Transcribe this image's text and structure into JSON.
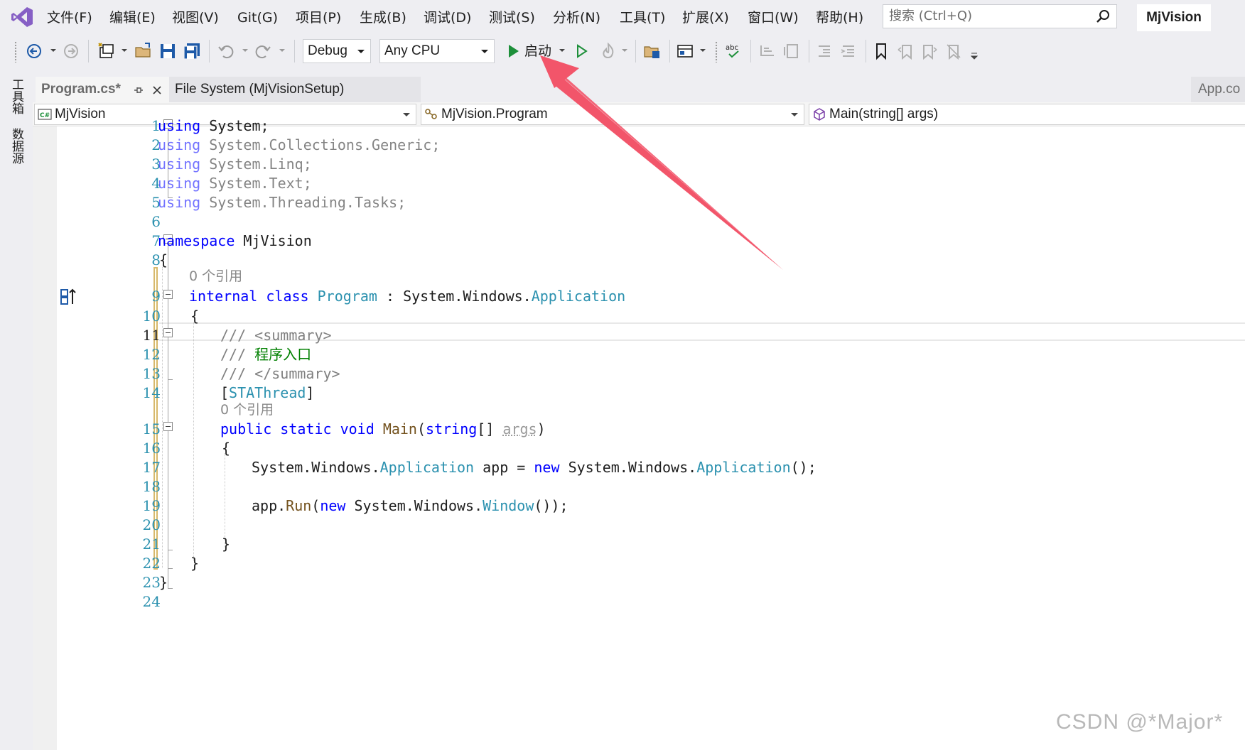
{
  "menu": {
    "items": [
      "文件(F)",
      "编辑(E)",
      "视图(V)",
      "Git(G)",
      "项目(P)",
      "生成(B)",
      "调试(D)",
      "测试(S)",
      "分析(N)",
      "工具(T)",
      "扩展(X)",
      "窗口(W)",
      "帮助(H)"
    ],
    "search_placeholder": "搜索 (Ctrl+Q)",
    "solution_name": "MjVision"
  },
  "toolbar": {
    "configuration": "Debug",
    "platform": "Any CPU",
    "start_label": "启动"
  },
  "side_tabs": [
    "工具箱",
    "数据源"
  ],
  "doc_tabs": {
    "active": "Program.cs*",
    "second": "File System (MjVisionSetup)",
    "right": "App.co"
  },
  "navbar": {
    "project": "MjVision",
    "class": "MjVision.Program",
    "member": "Main(string[] args)"
  },
  "editor": {
    "line_numbers": [
      "1",
      "2",
      "3",
      "4",
      "5",
      "6",
      "7",
      "8",
      "9",
      "10",
      "11",
      "12",
      "13",
      "14",
      "15",
      "16",
      "17",
      "18",
      "19",
      "20",
      "21",
      "22",
      "23",
      "24"
    ],
    "code": {
      "kw_using": "using",
      "system": "System",
      "semi": ";",
      "collections": "System.Collections.Generic",
      "linq": "System.Linq",
      "text": "System.Text",
      "tasks": "System.Threading.Tasks",
      "kw_namespace": "namespace",
      "ns_name": "MjVision",
      "open_brace": "{",
      "close_brace": "}",
      "refs_0": "0 个引用",
      "kw_internal": "internal",
      "kw_class": "class",
      "class_name": "Program",
      "colon": ":",
      "base_ns": "System.Windows.",
      "base_type": "Application",
      "doc_slash": "///",
      "xml_summary_open": "<summary>",
      "doc_text": "程序入口",
      "xml_summary_close": "</summary>",
      "attr_open": "[",
      "attr_name": "STAThread",
      "attr_close": "]",
      "kw_public": "public",
      "kw_static": "static",
      "kw_void": "void",
      "method_name": "Main",
      "paren_open": "(",
      "kw_string": "string",
      "array_brackets": "[]",
      "param_args": "args",
      "paren_close": ")",
      "l17_var": "app",
      "l17_eq": "=",
      "kw_new": "new",
      "ctor_call": "()",
      "l19_app": "app.",
      "l19_run": "Run",
      "type_window": "Window",
      "l19_end": "());"
    }
  },
  "watermark": "CSDN @*Major*"
}
